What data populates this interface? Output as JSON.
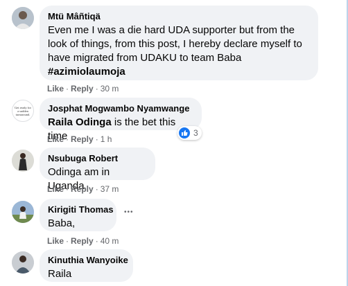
{
  "header_fragment": "",
  "comments": [
    {
      "author": "Mtü Mâñtiqä",
      "lines": [
        "Even me I was a die hard UDA supporter but from the",
        "look of things, from this post, I hereby declare myself to",
        "have migrated from UDAKU to team Baba"
      ],
      "hashtag": "#azimiolaumoja",
      "like": "Like",
      "reply": "Reply",
      "time": "30 m"
    },
    {
      "author": "Josphat Mogwambo Nyamwange",
      "mention": "Raila Odinga",
      "text_after_mention": " is the bet this time",
      "reaction_count": "3",
      "avatar_text": "Get ready for a sudden turnaround.",
      "like": "Like",
      "reply": "Reply",
      "time": "1 h"
    },
    {
      "author": "Nsubuga Robert",
      "text": "Odinga am in Uganda",
      "like": "Like",
      "reply": "Reply",
      "time": "37 m"
    },
    {
      "author": "Kirigiti Thomas",
      "text": "Baba,",
      "like": "Like",
      "reply": "Reply",
      "time": "40 m",
      "more": "•••"
    },
    {
      "author": "Kinuthia Wanyoike",
      "text": "Raila"
    }
  ],
  "colors": {
    "bubble": "#f0f2f5",
    "meta": "#65676b",
    "like_blue": "#1877f2"
  }
}
